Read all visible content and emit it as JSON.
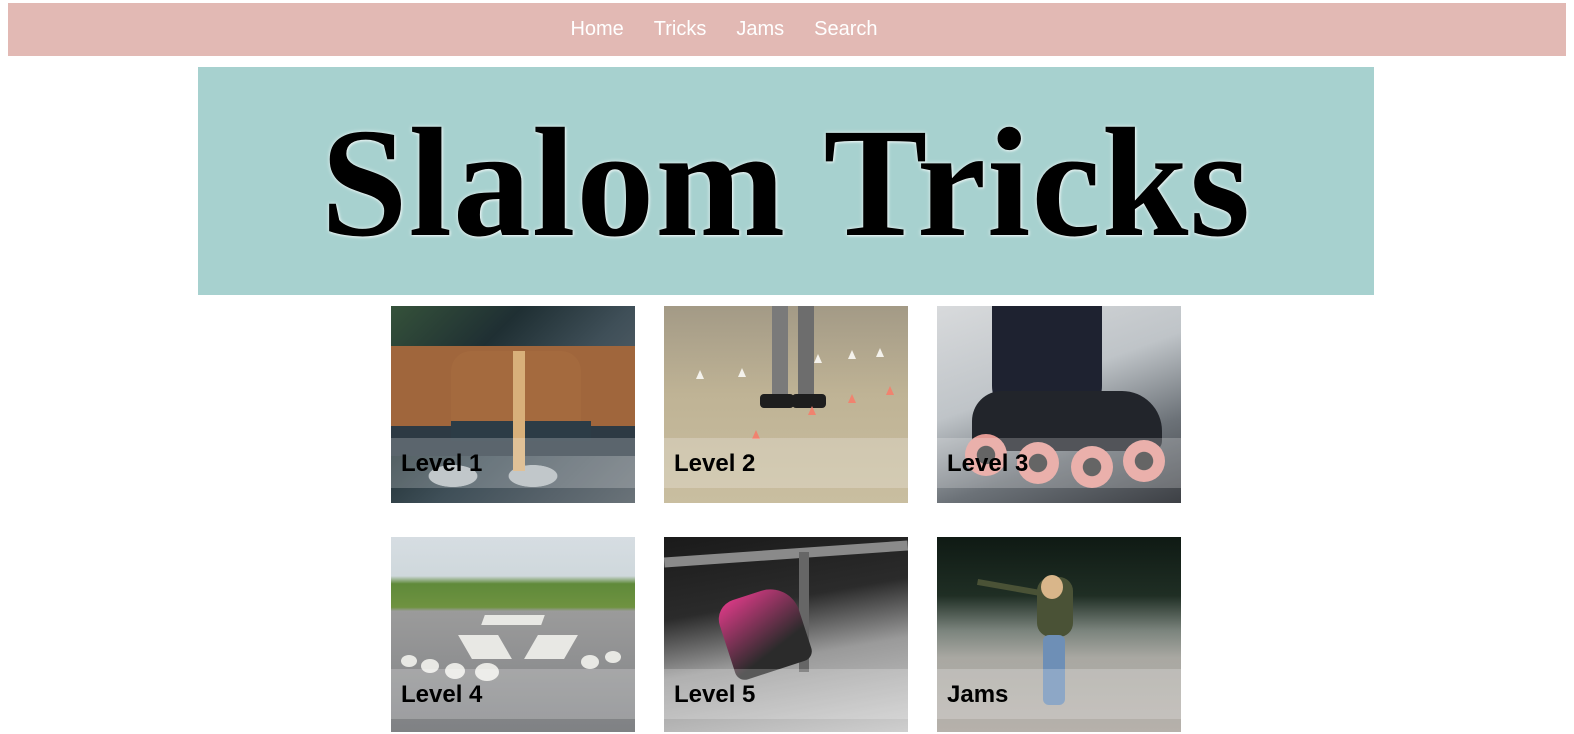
{
  "nav": {
    "items": [
      {
        "label": "Home"
      },
      {
        "label": "Tricks"
      },
      {
        "label": "Jams"
      },
      {
        "label": "Search"
      }
    ]
  },
  "hero": {
    "title": "Slalom Tricks"
  },
  "cards": [
    {
      "label": "Level 1"
    },
    {
      "label": "Level 2"
    },
    {
      "label": "Level 3"
    },
    {
      "label": "Level 4"
    },
    {
      "label": "Level 5"
    },
    {
      "label": "Jams"
    }
  ],
  "colors": {
    "navbar_bg": "#e2b9b4",
    "hero_bg": "#a7d1cf",
    "nav_text": "#ffffff"
  }
}
